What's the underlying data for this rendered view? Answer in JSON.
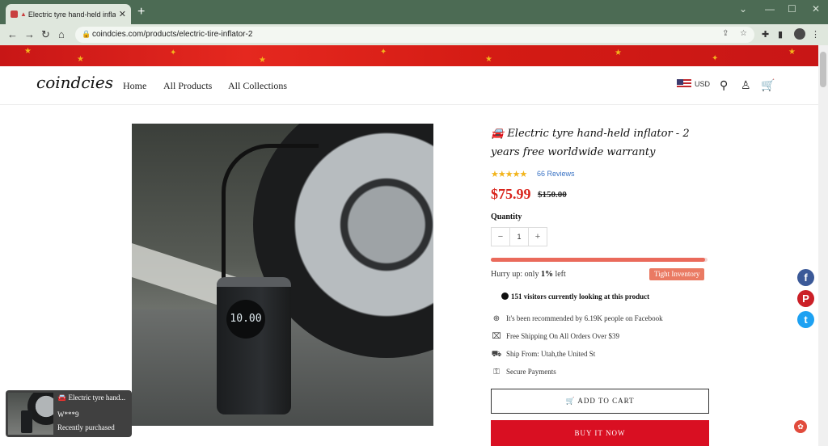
{
  "browser": {
    "tab_title": "Electric tyre hand-held inflato",
    "tab_close": "✕",
    "new_tab": "+",
    "url": "coindcies.com/products/electric-tire-inflator-2",
    "window_controls": [
      "⌄",
      "—",
      "☐",
      "✕"
    ]
  },
  "header": {
    "logo": "coindcies",
    "menu": [
      "Home",
      "All Products",
      "All Collections"
    ],
    "currency": "USD"
  },
  "product": {
    "title": "🚘 Electric tyre hand-held inflator - 2 years free worldwide warranty",
    "image_readout": "10.00",
    "stars": "★★★★★",
    "reviews": "66 Reviews",
    "price": "$75.99",
    "old_price": "$150.00",
    "quantity_label": "Quantity",
    "quantity": "1",
    "stock_fraction": 0.99,
    "hurry_prefix": "Hurry up: only",
    "hurry_value": "1%",
    "hurry_suffix": "left",
    "badge": "Tight Inventory",
    "visitors": "151 visitors currently looking at this product",
    "features": [
      {
        "icon": "globe-icon",
        "text": "It's been recommended by 6.19K people on Facebook"
      },
      {
        "icon": "gift-icon",
        "text": "Free Shipping On All Orders Over $39"
      },
      {
        "icon": "truck-icon",
        "text": "Ship From: Utah,the United St"
      },
      {
        "icon": "lock-icon",
        "text": "Secure Payments"
      }
    ],
    "add_to_cart": "ADD TO CART",
    "buy_now": "BUY IT NOW"
  },
  "popup": {
    "title": "🚘 Electric tyre hand...",
    "name": "W***9",
    "status": "Recently purchased"
  },
  "colors": {
    "price": "#d9241c",
    "buy_now": "#d90f22",
    "badge": "#ea7a63",
    "facebook": "#3b5998",
    "pinterest": "#cb2027",
    "twitter": "#1da1f2"
  }
}
